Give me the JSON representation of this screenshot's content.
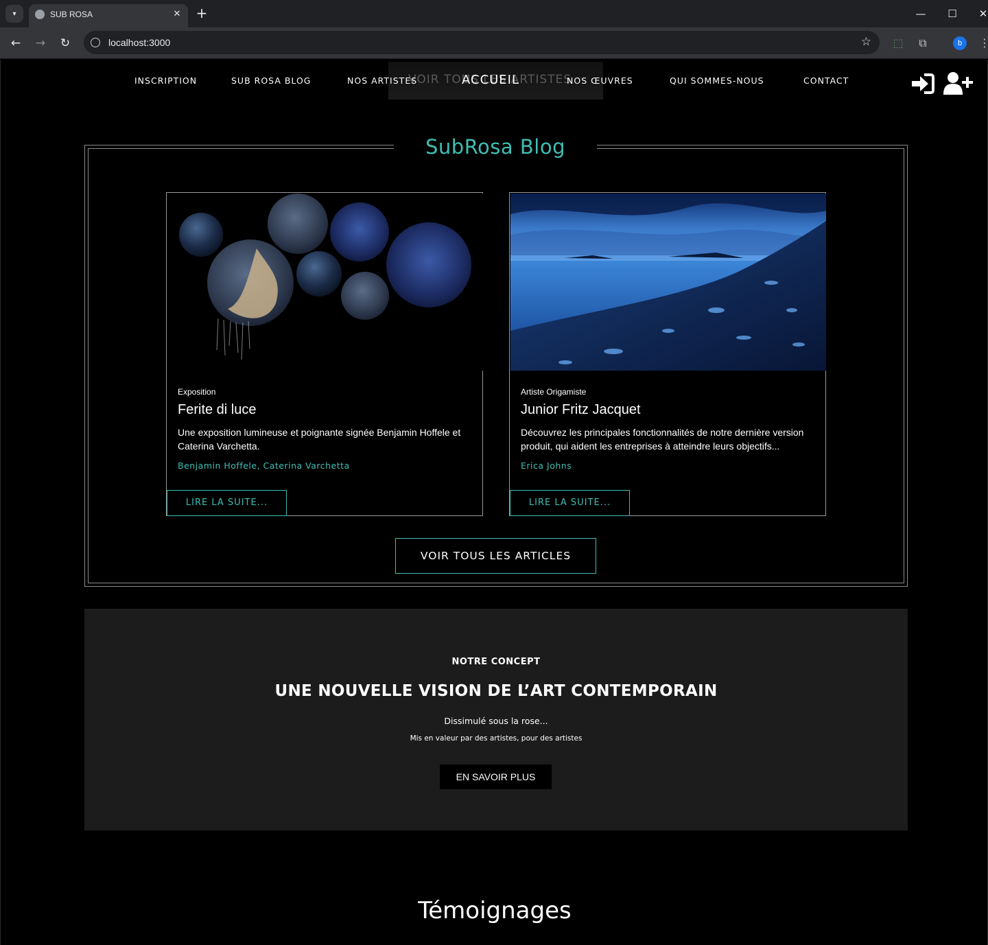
{
  "browser": {
    "tab_title": "SUB ROSA",
    "url": "localhost:3000",
    "profile_initial": "b"
  },
  "nav": {
    "ghost_text": "VOIR TOUS LES ARTISTES",
    "links": {
      "inscription": "INSCRIPTION",
      "blog": "SUB ROSA BLOG",
      "artistes": "NOS ARTISTES",
      "accueil": "ACCUEIL",
      "oeuvres": "NOS ŒUVRES",
      "qui": "QUI SOMMES-NOUS",
      "contact": "CONTACT"
    }
  },
  "blog": {
    "title": "SubRosa Blog",
    "cards": [
      {
        "category": "Exposition",
        "title": "Ferite di luce",
        "description": "Une exposition lumineuse et poignante signée Benjamin Hoffele et Caterina Varchetta.",
        "author": "Benjamin Hoffele, Caterina Varchetta",
        "button": "LIRE LA SUITE..."
      },
      {
        "category": "Artiste Origamiste",
        "title": "Junior Fritz Jacquet",
        "description": "Découvrez les principales fonctionnalités de notre dernière version produit, qui aident les entreprises à atteindre leurs objectifs...",
        "author": "Erica Johns",
        "button": "LIRE LA SUITE..."
      }
    ],
    "all_button": "VOIR TOUS LES ARTICLES"
  },
  "concept": {
    "kicker": "NOTRE CONCEPT",
    "title": "UNE NOUVELLE VISION DE L’ART CONTEMPORAIN",
    "subtitle": "Dissimulé sous la rose...",
    "tagline": "Mis en valeur par des artistes, pour des artistes",
    "button": "EN SAVOIR PLUS"
  },
  "testimonials": {
    "title": "Témoignages"
  },
  "colors": {
    "accent": "#3fbfb4",
    "background": "#000000",
    "concept_bg": "#1c1c1c"
  }
}
